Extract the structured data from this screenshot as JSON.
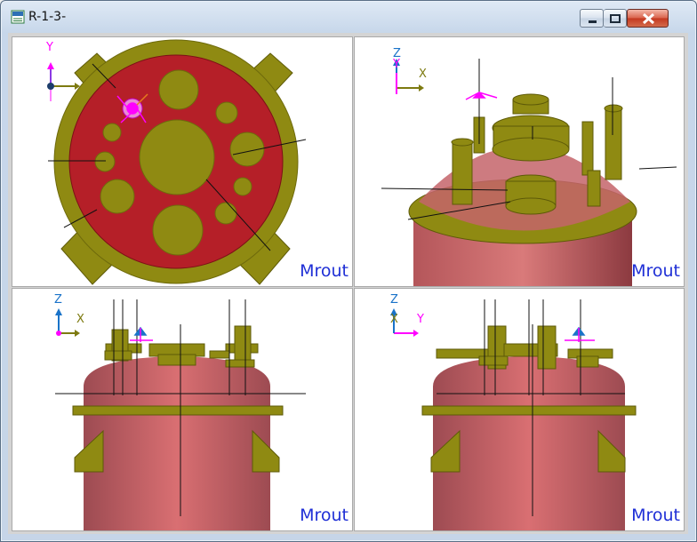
{
  "window": {
    "title": "R-1-3-"
  },
  "viewports": [
    {
      "id": "top",
      "label": "Mrout",
      "axes": [
        "Y"
      ]
    },
    {
      "id": "iso",
      "label": "Mrout",
      "axes": [
        "Z",
        "Y",
        "X"
      ]
    },
    {
      "id": "front",
      "label": "Mrout",
      "axes": [
        "Z",
        "X"
      ]
    },
    {
      "id": "side",
      "label": "Mrout",
      "axes": [
        "Z",
        "X",
        "Y"
      ]
    }
  ],
  "colors": {
    "vessel": "#b53a3e",
    "nozzle": "#8f8a12",
    "triad_blue": "#1a73c9",
    "triad_magenta": "#ff00ff",
    "label_blue": "#1f2fd6"
  }
}
